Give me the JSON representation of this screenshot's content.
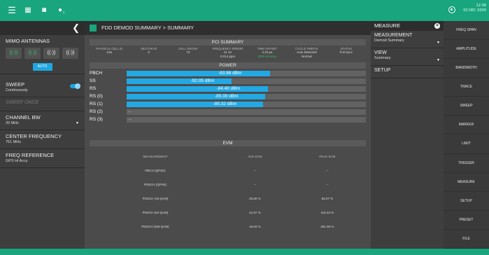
{
  "topbar": {
    "clock_time": "12:36",
    "clock_date": "03 DEC 0000",
    "status_badge": "3"
  },
  "left_panel": {
    "mimo": {
      "title": "MIMO ANTENNAS",
      "auto_label": "AUTO"
    },
    "sweep": {
      "title": "SWEEP",
      "value": "Continuously"
    },
    "sweep_once": {
      "label": "SWEEP ONCE"
    },
    "channel_bw": {
      "title": "CHANNEL BW",
      "value": "20 MHz"
    },
    "center_freq": {
      "title": "CENTER FREQUENCY",
      "value": "751 MHz"
    },
    "freq_ref": {
      "title": "FREQ REFERENCE",
      "value": "GPS Hi Accy"
    }
  },
  "main": {
    "breadcrumb": "FDD DEMOD SUMMARY  >  SUMMARY",
    "pci": {
      "title": "PCI SUMMARY",
      "headers": [
        "PHYSICAL CELL ID",
        "SECTOR ID",
        "CELL GROUP",
        "FREQUENCY ERROR",
        "TIME OFFSET",
        "CYCLIC PREFIX",
        "STATUS"
      ],
      "values": [
        "216",
        "0",
        "72",
        "11 Hz",
        "4.23 µs",
        "Auto Detected",
        "Full Sync"
      ],
      "values2": [
        "",
        "",
        "",
        "0.014 ppm",
        "GPS Hi Accy",
        "Normal",
        ""
      ]
    },
    "power": {
      "title": "POWER",
      "rows": [
        {
          "label": "PBCH",
          "value": "-83.86 dBm",
          "fill": 0.6
        },
        {
          "label": "SS",
          "value": "-92.05 dBm",
          "fill": 0.44
        },
        {
          "label": "RS",
          "value": "-84.40 dBm",
          "fill": 0.59
        },
        {
          "label": "RS (0)",
          "value": "-85.00 dBm",
          "fill": 0.58
        },
        {
          "label": "RS (1)",
          "value": "-85.32 dBm",
          "fill": 0.57
        },
        {
          "label": "RS (2)",
          "value": "--",
          "fill": 0
        },
        {
          "label": "RS (3)",
          "value": "--",
          "fill": 0
        }
      ]
    },
    "evm": {
      "title": "EVM",
      "headers": [
        "MEASUREMENT",
        "AVG EVM",
        "PEAK EVM"
      ],
      "rows": [
        [
          "PBCH (QPSK)",
          "--",
          "--"
        ],
        [
          "PDSCH (QPSK)",
          "--",
          "--"
        ],
        [
          "PDSCH (16-QAM)",
          "26.80 %",
          "56.07 %"
        ],
        [
          "PDSCH (64-QAM)",
          "21.57 %",
          "116.43 %"
        ],
        [
          "PDSCH (256-QAM)",
          "15.84 %",
          "251.59 %"
        ]
      ]
    }
  },
  "measure_panel": {
    "title": "MEASURE",
    "measurement": {
      "title": "MEASUREMENT",
      "value": "Demod Summary"
    },
    "view": {
      "title": "VIEW",
      "value": "Summary"
    },
    "setup": {
      "title": "SETUP"
    }
  },
  "soft_keys": [
    "FREQ SPAN",
    "AMPLITUDE",
    "BANDWIDTH",
    "TRACE",
    "SWEEP",
    "MARKER",
    "LIMIT",
    "TRIGGER",
    "MEASURE",
    "SETUP",
    "PRESET",
    "FILE"
  ],
  "colors": {
    "accent": "#19a57d",
    "bar": "#22a8e3",
    "green_text": "#2fc96a"
  },
  "icons": [
    "menu-icon",
    "grid-icon",
    "camera-icon",
    "info-icon",
    "gps-icon",
    "back-icon",
    "close-icon",
    "antenna-icon"
  ]
}
